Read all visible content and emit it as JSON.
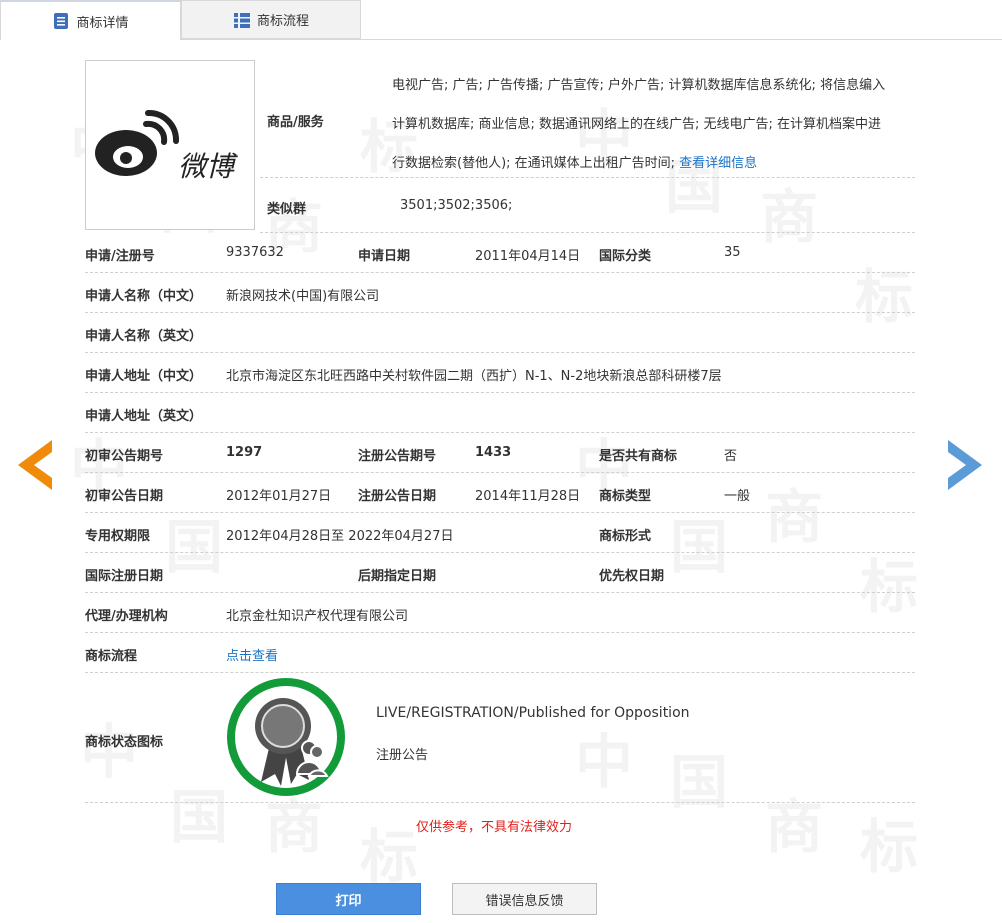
{
  "tabs": [
    {
      "label": "商标详情",
      "active": true,
      "icon": "document-list-icon"
    },
    {
      "label": "商标流程",
      "active": false,
      "icon": "grid-list-icon"
    }
  ],
  "watermark": [
    "中",
    "国",
    "商",
    "标"
  ],
  "logo": {
    "brand_text": "微博",
    "icon": "weibo-eye-logo"
  },
  "goods": {
    "label": "商品/服务",
    "text_lines": [
      "电视广告; 广告; 广告传播; 广告宣传; 户外广告; 计算机数据库信息系统化; 将信息编入",
      "计算机数据库; 商业信息; 数据通讯网络上的在线广告; 无线电广告; 在计算机档案中进",
      "行数据检索(替他人); 在通讯媒体上出租广告时间; "
    ],
    "more_link": "查看详细信息"
  },
  "similar_group": {
    "label": "类似群",
    "value": "3501;3502;3506;"
  },
  "fields": {
    "reg_no": {
      "label": "申请/注册号",
      "value": "9337632"
    },
    "apply_date": {
      "label": "申请日期",
      "value": "2011年04月14日"
    },
    "intl_class": {
      "label": "国际分类",
      "value": "35"
    },
    "applicant_cn": {
      "label": "申请人名称（中文）",
      "value": "新浪网技术(中国)有限公司"
    },
    "applicant_en": {
      "label": "申请人名称（英文）",
      "value": ""
    },
    "address_cn": {
      "label": "申请人地址（中文）",
      "value": "北京市海淀区东北旺西路中关村软件园二期（西扩）N-1、N-2地块新浪总部科研楼7层"
    },
    "address_en": {
      "label": "申请人地址（英文）",
      "value": ""
    },
    "prelim_no": {
      "label": "初审公告期号",
      "value": "1297"
    },
    "reg_pub_no": {
      "label": "注册公告期号",
      "value": "1433"
    },
    "shared": {
      "label": "是否共有商标",
      "value": "否"
    },
    "prelim_date": {
      "label": "初审公告日期",
      "value": "2012年01月27日"
    },
    "reg_pub_date": {
      "label": "注册公告日期",
      "value": "2014年11月28日"
    },
    "tm_type": {
      "label": "商标类型",
      "value": "一般"
    },
    "exclusive": {
      "label": "专用权期限",
      "value": "2012年04月28日至 2022年04月27日"
    },
    "tm_form": {
      "label": "商标形式",
      "value": ""
    },
    "intl_reg_date": {
      "label": "国际注册日期",
      "value": ""
    },
    "later_date": {
      "label": "后期指定日期",
      "value": ""
    },
    "priority_date": {
      "label": "优先权日期",
      "value": ""
    },
    "agent": {
      "label": "代理/办理机构",
      "value": "北京金杜知识产权代理有限公司"
    },
    "flow": {
      "label": "商标流程",
      "link": "点击查看"
    }
  },
  "status": {
    "label": "商标状态图标",
    "icon": "certificate-badge-icon",
    "text_en": "LIVE/REGISTRATION/Published for Opposition",
    "text_cn": "注册公告",
    "ring_color": "#139b3a"
  },
  "disclaimer": "仅供参考，不具有法律效力",
  "buttons": {
    "print": "打印",
    "feedback": "错误信息反馈"
  },
  "nav": {
    "prev_color": "#f08a0a",
    "next_color": "#5a9bd8"
  }
}
